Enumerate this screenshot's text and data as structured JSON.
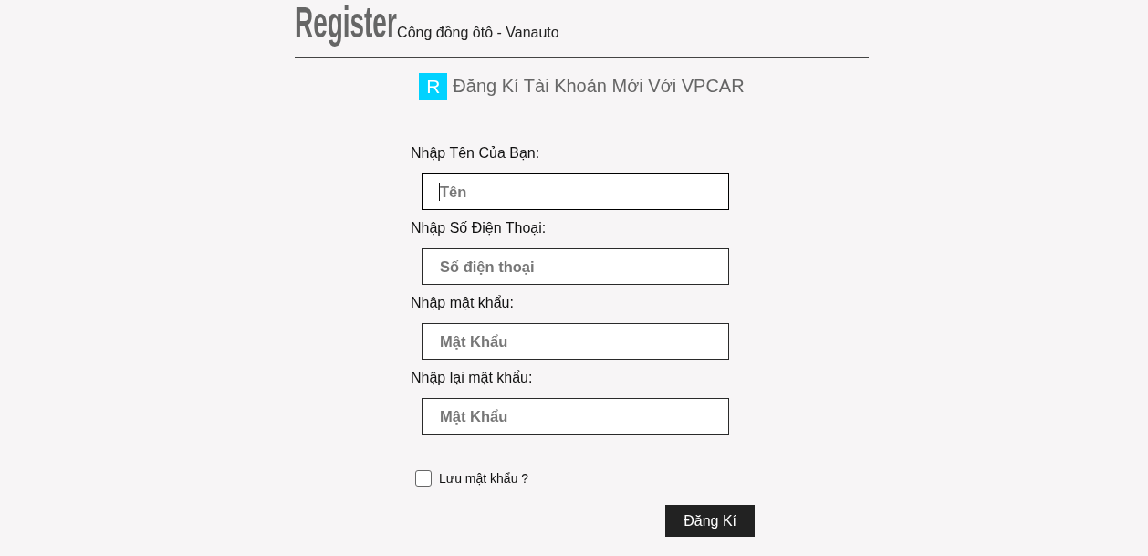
{
  "header": {
    "title": "Register",
    "subtitle": "Công đồng ôtô - Vanauto"
  },
  "heading": {
    "logo_letter": "R",
    "text": "Đăng Kí Tài Khoản Mới Với VPCAR"
  },
  "fields": [
    {
      "label": "Nhập Tên Của Bạn:",
      "placeholder": "Tên",
      "focused": true
    },
    {
      "label": "Nhập Số Điện Thoại:",
      "placeholder": "Số điện thoại",
      "focused": false
    },
    {
      "label": "Nhập mật khẩu:",
      "placeholder": "Mật Khẩu",
      "focused": false
    },
    {
      "label": "Nhập lại mật khẩu:",
      "placeholder": "Mật Khẩu",
      "focused": false
    }
  ],
  "remember": {
    "label": "Lưu mật khẩu ?",
    "checked": false
  },
  "submit_button": "Đăng Kí"
}
